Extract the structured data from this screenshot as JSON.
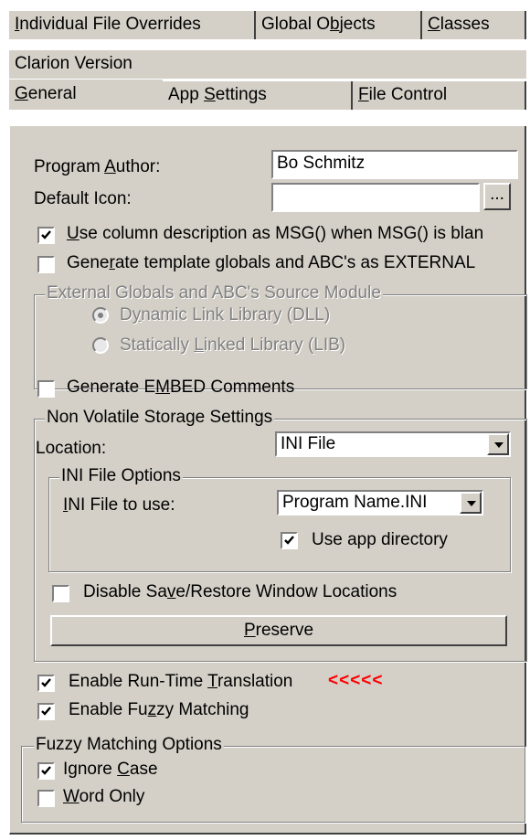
{
  "tabs": {
    "row1": [
      {
        "pre": "",
        "ul": "I",
        "post": "ndividual File Overrides"
      },
      {
        "pre": "Global O",
        "ul": "b",
        "post": "jects"
      },
      {
        "pre": "",
        "ul": "C",
        "post": "lasses"
      }
    ],
    "row2": [
      {
        "pre": "Clarion Version",
        "ul": "",
        "post": ""
      }
    ],
    "row3": [
      {
        "pre": "",
        "ul": "G",
        "post": "eneral"
      },
      {
        "pre": "App ",
        "ul": "S",
        "post": "ettings"
      },
      {
        "pre": "",
        "ul": "F",
        "post": "ile Control"
      }
    ]
  },
  "general": {
    "program_author": {
      "pre": "Program ",
      "ul": "A",
      "post": "uthor:",
      "value": "Bo Schmitz"
    },
    "default_icon": {
      "label": "Default Icon:",
      "value": "",
      "browse": "..."
    },
    "use_column_desc": {
      "pre": "",
      "ul": "U",
      "post": "se column description as MSG() when MSG() is blan",
      "checked": true
    },
    "generate_template_globals": {
      "pre": "Gene",
      "ul": "r",
      "post": "ate template globals and ABC's as EXTERNAL",
      "checked": false
    },
    "external_group": {
      "title": "External Globals and ABC's Source Module",
      "dll": {
        "pre": "D",
        "ul": "y",
        "post": "namic Link Library (DLL)"
      },
      "lib": {
        "pre": "Statically ",
        "ul": "L",
        "post": "inked Library (LIB)"
      }
    },
    "embed_comments": {
      "pre": "Generate E",
      "ul": "M",
      "post": "BED Comments",
      "checked": false
    },
    "nvs_group": {
      "title": "Non Volatile Storage Settings",
      "location_label": "Location:",
      "location_value": "INI File",
      "ini_group": {
        "title": "INI File Options",
        "ini_label": {
          "pre": "",
          "ul": "I",
          "post": "NI File to use:"
        },
        "ini_value": "Program Name.INI",
        "use_app_dir": {
          "label": "Use app directory",
          "checked": true
        }
      },
      "disable_save": {
        "pre": "Disable Sa",
        "ul": "v",
        "post": "e/Restore Window Locations",
        "checked": false
      },
      "preserve": {
        "pre": "",
        "ul": "P",
        "post": "reserve"
      }
    },
    "runtime_translation": {
      "pre": "Enable Run-Time ",
      "ul": "T",
      "post": "ranslation",
      "checked": true,
      "marker": "<<<<<",
      "marker_color": "#ff0000"
    },
    "fuzzy_matching": {
      "pre": "Enable Fu",
      "ul": "z",
      "post": "zy Matching",
      "checked": true
    },
    "fuzzy_group": {
      "title": "Fuzzy Matching Options",
      "ignore_case": {
        "pre": "Ignore ",
        "ul": "C",
        "post": "ase",
        "checked": true
      },
      "word_only": {
        "pre": "",
        "ul": "W",
        "post": "ord Only",
        "checked": false
      }
    }
  }
}
